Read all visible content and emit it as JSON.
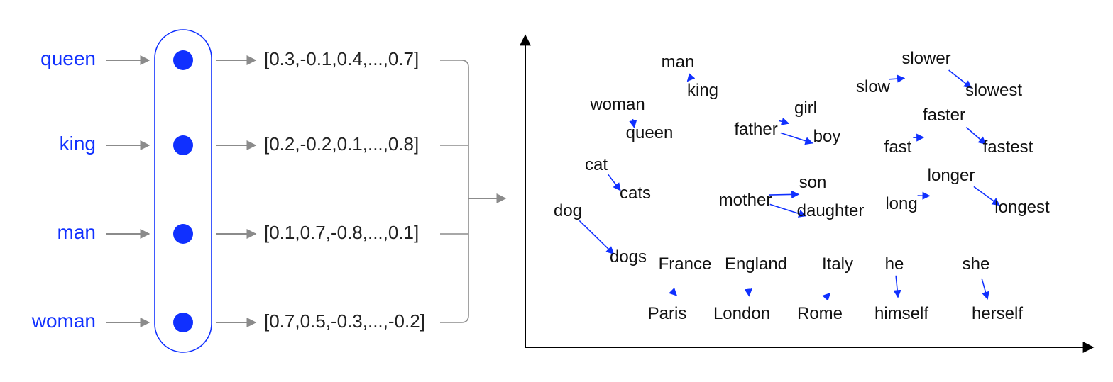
{
  "inputs": [
    {
      "word": "queen",
      "vector": "[0.3,-0.1,0.4,...,0.7]"
    },
    {
      "word": "king",
      "vector": "[0.2,-0.2,0.1,...,0.8]"
    },
    {
      "word": "man",
      "vector": "[0.1,0.7,-0.8,...,0.1]"
    },
    {
      "word": "woman",
      "vector": "[0.7,0.5,-0.3,...,-0.2]"
    }
  ],
  "chart_data": {
    "type": "scatter",
    "title": "",
    "xlabel": "",
    "ylabel": "",
    "xlim": [
      0,
      820
    ],
    "ylim": [
      0,
      440
    ],
    "points": [
      {
        "label": "man",
        "x": 215,
        "y": 395
      },
      {
        "label": "king",
        "x": 250,
        "y": 355
      },
      {
        "label": "woman",
        "x": 130,
        "y": 335
      },
      {
        "label": "queen",
        "x": 175,
        "y": 295
      },
      {
        "label": "girl",
        "x": 395,
        "y": 330
      },
      {
        "label": "father",
        "x": 325,
        "y": 300
      },
      {
        "label": "boy",
        "x": 425,
        "y": 290
      },
      {
        "label": "cat",
        "x": 100,
        "y": 250
      },
      {
        "label": "cats",
        "x": 155,
        "y": 210
      },
      {
        "label": "son",
        "x": 405,
        "y": 225
      },
      {
        "label": "mother",
        "x": 310,
        "y": 200
      },
      {
        "label": "daughter",
        "x": 430,
        "y": 185
      },
      {
        "label": "dog",
        "x": 60,
        "y": 185
      },
      {
        "label": "dogs",
        "x": 145,
        "y": 120
      },
      {
        "label": "France",
        "x": 225,
        "y": 110
      },
      {
        "label": "England",
        "x": 325,
        "y": 110
      },
      {
        "label": "Italy",
        "x": 440,
        "y": 110
      },
      {
        "label": "he",
        "x": 520,
        "y": 110
      },
      {
        "label": "she",
        "x": 635,
        "y": 110
      },
      {
        "label": "Paris",
        "x": 200,
        "y": 40
      },
      {
        "label": "London",
        "x": 305,
        "y": 40
      },
      {
        "label": "Rome",
        "x": 415,
        "y": 40
      },
      {
        "label": "himself",
        "x": 530,
        "y": 40
      },
      {
        "label": "herself",
        "x": 665,
        "y": 40
      },
      {
        "label": "slow",
        "x": 490,
        "y": 360
      },
      {
        "label": "slower",
        "x": 565,
        "y": 400
      },
      {
        "label": "slowest",
        "x": 660,
        "y": 355
      },
      {
        "label": "fast",
        "x": 525,
        "y": 275
      },
      {
        "label": "faster",
        "x": 590,
        "y": 320
      },
      {
        "label": "fastest",
        "x": 680,
        "y": 275
      },
      {
        "label": "long",
        "x": 530,
        "y": 195
      },
      {
        "label": "longer",
        "x": 600,
        "y": 235
      },
      {
        "label": "longest",
        "x": 700,
        "y": 190
      }
    ],
    "arrows": [
      {
        "from": "queen",
        "to": "woman"
      },
      {
        "from": "king",
        "to": "man"
      },
      {
        "from": "father",
        "to": "girl"
      },
      {
        "from": "father",
        "to": "boy"
      },
      {
        "from": "cat",
        "to": "cats"
      },
      {
        "from": "dog",
        "to": "dogs"
      },
      {
        "from": "mother",
        "to": "son"
      },
      {
        "from": "mother",
        "to": "daughter"
      },
      {
        "from": "Paris",
        "to": "France"
      },
      {
        "from": "London",
        "to": "England"
      },
      {
        "from": "Rome",
        "to": "Italy"
      },
      {
        "from": "he",
        "to": "himself"
      },
      {
        "from": "she",
        "to": "herself"
      },
      {
        "from": "slow",
        "to": "slower"
      },
      {
        "from": "slower",
        "to": "slowest"
      },
      {
        "from": "fast",
        "to": "faster"
      },
      {
        "from": "faster",
        "to": "fastest"
      },
      {
        "from": "long",
        "to": "longer"
      },
      {
        "from": "longer",
        "to": "longest"
      }
    ]
  }
}
